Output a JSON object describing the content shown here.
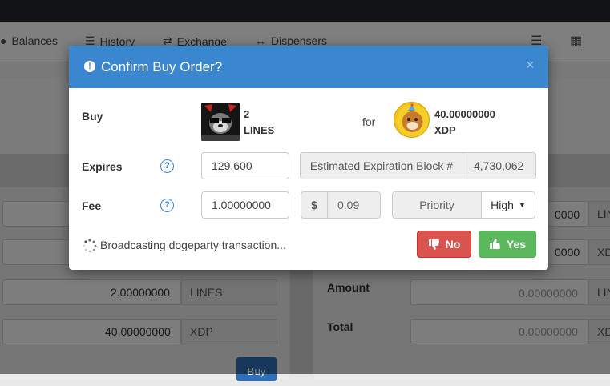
{
  "nav": {
    "balances": "Balances",
    "history": "History",
    "exchange": "Exchange",
    "dispensers": "Dispensers"
  },
  "background": {
    "buy_amount_value": "2.00000000",
    "buy_amount_unit": "LINES",
    "buy_total_value": "40.00000000",
    "buy_total_unit": "XDP",
    "right_row1_value": "0000",
    "right_row1_unit": "LIN",
    "right_row2_value": "0000",
    "right_row2_unit": "XD",
    "amount_label": "Amount",
    "amount_value": "0.00000000",
    "amount_unit": "LIN",
    "total_label": "Total",
    "total_value": "0.00000000",
    "total_unit": "XD",
    "buy_button": "Buy"
  },
  "modal": {
    "title": "Confirm Buy Order?",
    "close_symbol": "×",
    "buy_label": "Buy",
    "asset_quantity": "2",
    "asset_name": "LINES",
    "for_label": "for",
    "pay_quantity": "40.00000000",
    "pay_asset": "XDP",
    "expires_label": "Expires",
    "expires_value": "129,600",
    "estimated_block_label": "Estimated Expiration Block #",
    "estimated_block_value": "4,730,062",
    "fee_label": "Fee",
    "fee_value": "1.00000000",
    "fee_currency_symbol": "$",
    "fee_usd_value": "0.09",
    "priority_label": "Priority",
    "priority_value": "High",
    "status_text": "Broadcasting dogeparty transaction...",
    "no_button": "No",
    "yes_button": "Yes"
  },
  "colors": {
    "header_blue": "#3a87cf",
    "no_red": "#d9534f",
    "yes_green": "#5cb85c"
  }
}
